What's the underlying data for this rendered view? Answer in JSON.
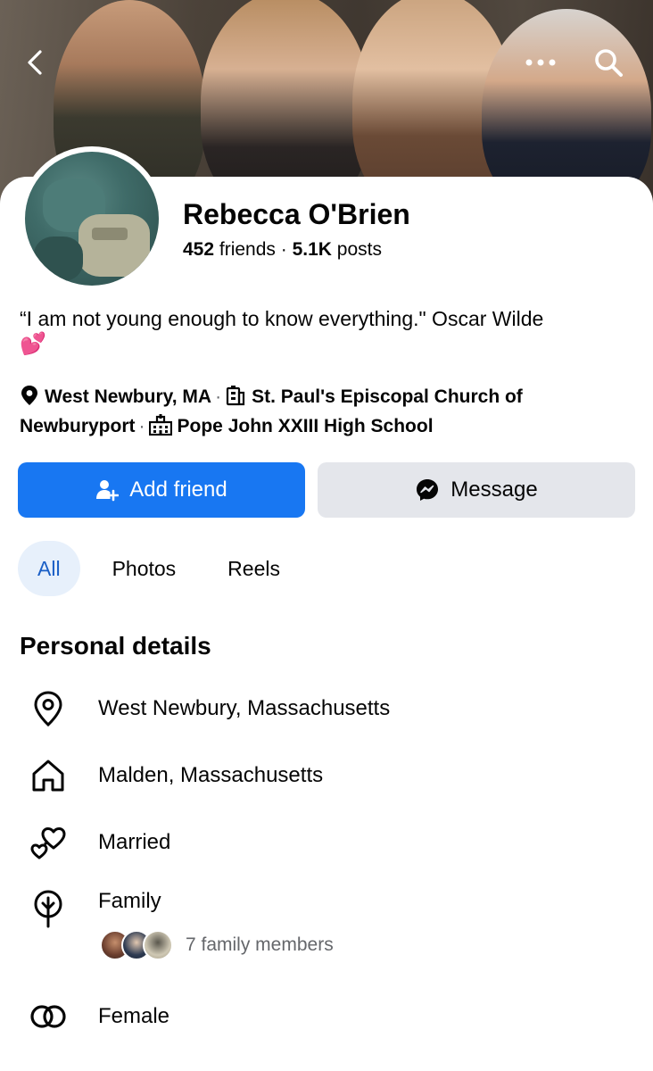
{
  "profile": {
    "name": "Rebecca O'Brien",
    "friends_count": "452",
    "friends_label": " friends",
    "dot": " · ",
    "posts_count": "5.1K",
    "posts_label": " posts",
    "bio": "“I am not young enough to know everything.\" Oscar Wilde",
    "bio_emoji": "💕"
  },
  "meta": {
    "location": "West Newbury, MA",
    "workplace": "St. Paul's Episcopal Church of Newburyport",
    "school": "Pope John XXIII High School",
    "separator": "·"
  },
  "actions": {
    "add_friend": "Add friend",
    "message": "Message"
  },
  "tabs": [
    {
      "label": "All",
      "active": true
    },
    {
      "label": "Photos",
      "active": false
    },
    {
      "label": "Reels",
      "active": false
    }
  ],
  "details": {
    "title": "Personal details",
    "current_city": "West Newbury, Massachusetts",
    "hometown": "Malden, Massachusetts",
    "relationship": "Married",
    "family_label": "Family",
    "family_members": "7 family members",
    "gender": "Female"
  },
  "colors": {
    "accent": "#1877f2",
    "tab_active_bg": "#e7f0fb",
    "tab_active_text": "#1a5fc6",
    "secondary_button": "#e4e6eb",
    "muted_text": "#65676b"
  },
  "icons": {
    "back": "chevron-left-icon",
    "more": "more-dots-icon",
    "search": "search-icon",
    "location": "location-pin-icon",
    "work": "building-icon",
    "school": "school-icon",
    "add_friend": "add-person-icon",
    "messenger": "messenger-icon",
    "current_city": "location-pin-outline-icon",
    "hometown": "home-icon",
    "relationship": "hearts-icon",
    "family": "family-tree-icon",
    "gender": "gender-rings-icon"
  }
}
